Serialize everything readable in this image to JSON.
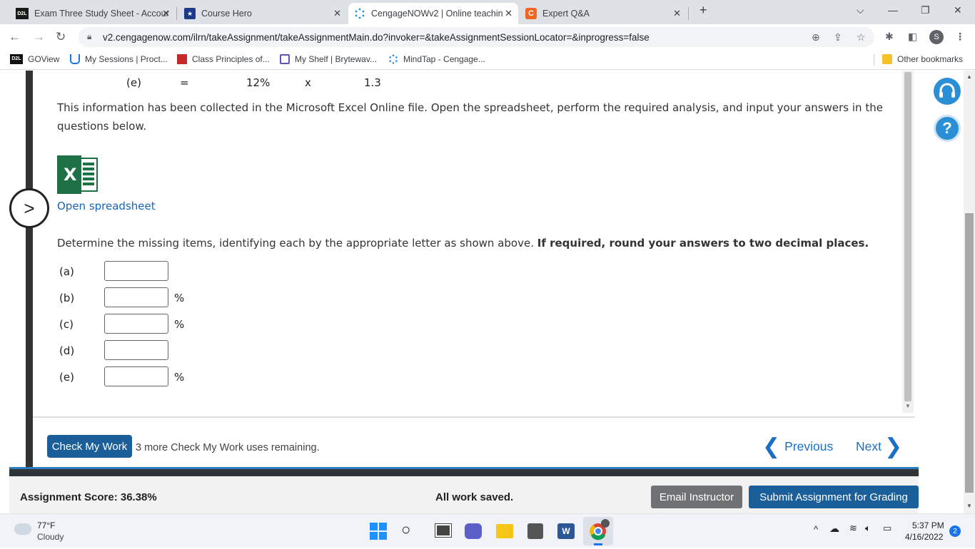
{
  "browser": {
    "tabs": [
      {
        "label": "Exam Three Study Sheet - Accour",
        "favicon": "D2L",
        "active": false
      },
      {
        "label": "Course Hero",
        "favicon": "★",
        "active": false
      },
      {
        "label": "CengageNOWv2 | Online teachin",
        "favicon": "cengage-icon",
        "active": true
      },
      {
        "label": "Expert Q&A",
        "favicon": "C",
        "active": false
      }
    ],
    "url": "v2.cengagenow.com/ilrn/takeAssignment/takeAssignmentMain.do?invoker=&takeAssignmentSessionLocator=&inprogress=false",
    "profile_initial": "S",
    "bookmarks": [
      {
        "label": "GOView",
        "icon": "D2L"
      },
      {
        "label": "My Sessions | Proct...",
        "icon": "proctor-icon"
      },
      {
        "label": "Class Principles of...",
        "icon": "class-icon"
      },
      {
        "label": "My Shelf | Brytewav...",
        "icon": "shelf-icon"
      },
      {
        "label": "MindTap - Cengage...",
        "icon": "cengage-icon"
      }
    ],
    "other_bookmarks": "Other bookmarks"
  },
  "content": {
    "eq_row": {
      "letter": "(e)",
      "equals": "=",
      "rate": "12%",
      "times": "x",
      "factor": "1.3"
    },
    "intro": "This information has been collected in the Microsoft Excel Online file. Open the spreadsheet, perform the required analysis, and input your answers in the questions below.",
    "open_link": "Open spreadsheet",
    "instruction": "Determine the missing items, identifying each by the appropriate letter as shown above.",
    "instruction_bold": "If required, round your answers to two decimal places.",
    "questions": [
      {
        "label": "(a)",
        "unit": "",
        "value": ""
      },
      {
        "label": "(b)",
        "unit": "%",
        "value": ""
      },
      {
        "label": "(c)",
        "unit": "%",
        "value": ""
      },
      {
        "label": "(d)",
        "unit": "",
        "value": ""
      },
      {
        "label": "(e)",
        "unit": "%",
        "value": ""
      }
    ]
  },
  "actions": {
    "check_label": "Check My Work",
    "remaining": "3 more Check My Work uses remaining.",
    "previous": "Previous",
    "next": "Next"
  },
  "footer": {
    "score": "Assignment Score: 36.38%",
    "saved": "All work saved.",
    "email": "Email Instructor",
    "submit": "Submit Assignment for Grading"
  },
  "taskbar": {
    "temp": "77°F",
    "weather": "Cloudy",
    "time": "5:37 PM",
    "date": "4/16/2022",
    "notifications": "2"
  },
  "colors": {
    "accent": "#1a5e9a",
    "link": "#1565c0",
    "excel": "#1e7145"
  }
}
